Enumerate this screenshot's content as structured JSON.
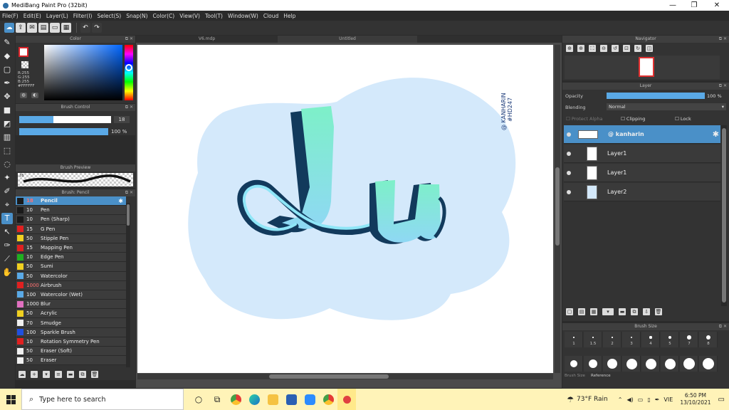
{
  "window": {
    "title": "MediBang Paint Pro (32bit)",
    "minimize": "—",
    "maximize": "❐",
    "close": "✕"
  },
  "menu": [
    "File(F)",
    "Edit(E)",
    "Layer(L)",
    "Filter(I)",
    "Select(S)",
    "Snap(N)",
    "Color(C)",
    "View(V)",
    "Tool(T)",
    "Window(W)",
    "Cloud",
    "Help"
  ],
  "color_panel": {
    "title": "Color",
    "rgb": [
      "R:255",
      "G:255",
      "B:255",
      "#FFFFFF"
    ]
  },
  "brush_control": {
    "title": "Brush Control",
    "size": "18",
    "opacity": "100 %",
    "size_fraction": 0.37,
    "opacity_fraction": 1.0
  },
  "brush_preview": {
    "title": "Brush Preview",
    "size": "18"
  },
  "brush_panel": {
    "title": "Brush: Pencil",
    "items": [
      {
        "size": "18",
        "name": "Pencil",
        "color": "#1a1a1a",
        "selected": true
      },
      {
        "size": "10",
        "name": "Pen",
        "color": "#1a1a1a"
      },
      {
        "size": "10",
        "name": "Pen (Sharp)",
        "color": "#1a1a1a"
      },
      {
        "size": "15",
        "name": "G Pen",
        "color": "#e02020"
      },
      {
        "size": "50",
        "name": "Stipple Pen",
        "color": "#f0d020"
      },
      {
        "size": "15",
        "name": "Mapping Pen",
        "color": "#e02020"
      },
      {
        "size": "10",
        "name": "Edge Pen",
        "color": "#20b020"
      },
      {
        "size": "50",
        "name": "Sumi",
        "color": "#f0d020"
      },
      {
        "size": "50",
        "name": "Watercolor",
        "color": "#5aa9e6"
      },
      {
        "size": "1000",
        "name": "Airbrush",
        "color": "#e02020",
        "red": true
      },
      {
        "size": "100",
        "name": "Watercolor (Wet)",
        "color": "#5aa9e6"
      },
      {
        "size": "1000",
        "name": "Blur",
        "color": "#e070c0"
      },
      {
        "size": "50",
        "name": "Acrylic",
        "color": "#f0d020"
      },
      {
        "size": "70",
        "name": "Smudge",
        "color": "#f0f0f0"
      },
      {
        "size": "100",
        "name": "Sparkle Brush",
        "color": "#2050e0"
      },
      {
        "size": "10",
        "name": "Rotation Symmetry Pen",
        "color": "#e02020"
      },
      {
        "size": "50",
        "name": "Eraser (Soft)",
        "color": "#f0f0f0"
      },
      {
        "size": "50",
        "name": "Eraser",
        "color": "#f0f0f0"
      }
    ]
  },
  "tabs": [
    "V6.mdp",
    "Untitled"
  ],
  "canvas": {
    "watermark": "@ KANHARIN",
    "hashtag": "#HD247",
    "letters": "Ju"
  },
  "navigator": {
    "title": "Navigator"
  },
  "layer_panel": {
    "title": "Layer",
    "opacity_label": "Opacity",
    "opacity_value": "100 %",
    "blending_label": "Blending",
    "blending_value": "Normal",
    "protect_alpha": "Protect Alpha",
    "clipping": "Clipping",
    "lock": "Lock",
    "layers": [
      {
        "name": "@ kanharin",
        "selected": true
      },
      {
        "name": "Layer1"
      },
      {
        "name": "Layer1"
      },
      {
        "name": "Layer2"
      }
    ]
  },
  "brush_size": {
    "title": "Brush Size",
    "labels": [
      "1",
      "1.5",
      "2",
      "3",
      "4",
      "5",
      "7",
      "8"
    ],
    "tab_size": "Brush Size",
    "tab_reference": "Reference"
  },
  "taskbar": {
    "search_placeholder": "Type here to search",
    "weather": "73°F Rain",
    "lang": "VIE",
    "time": "6:50 PM",
    "date": "13/10/2021"
  },
  "colors": {
    "accent": "#4a90c8",
    "canvas_blob": "#d4e9fb",
    "letters_fill": "#7de8d2",
    "letters_dark": "#123a5c"
  }
}
